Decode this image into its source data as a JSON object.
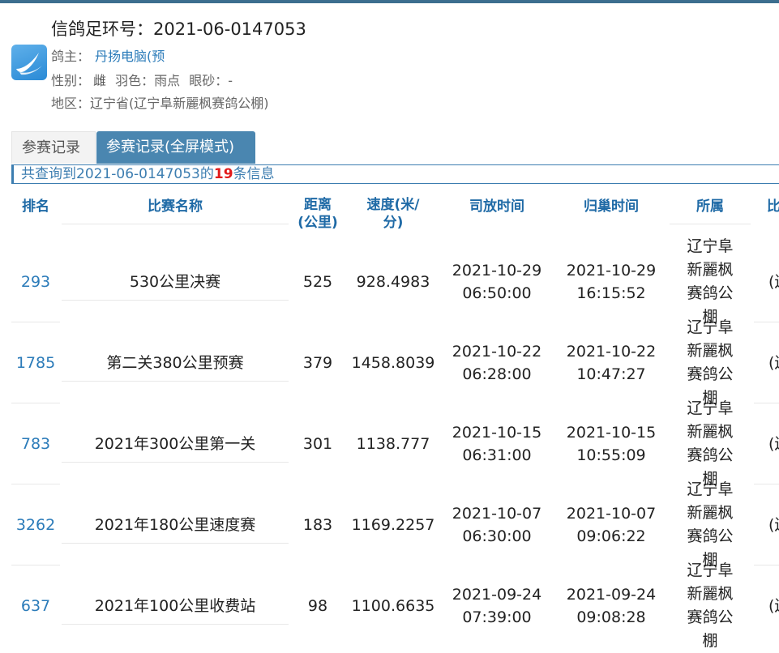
{
  "header": {
    "ring_label": "信鸽足环号：",
    "ring_number": "2021-06-0147053",
    "owner_label": "鸽主：",
    "owner_name": "丹扬电脑(预",
    "gender_label": "性别：",
    "gender_value": "雌",
    "color_label": "羽色：",
    "color_value": "雨点",
    "eye_label": "眼砂：",
    "eye_value": "-",
    "region_label": "地区：",
    "region_value": "辽宁省(辽宁阜新麗枫赛鸽公棚)"
  },
  "tabs": [
    {
      "label": "参赛记录",
      "active": false
    },
    {
      "label": "参赛记录(全屏模式)",
      "active": true
    }
  ],
  "summary": {
    "prefix": "共查询到",
    "ring": "2021-06-0147053",
    "mid": "的",
    "count": "19",
    "suffix": "条信息"
  },
  "table": {
    "columns": [
      "排名",
      "比赛名称",
      "距离(公里)",
      "速度(米/分)",
      "司放时间",
      "归巢时间",
      "所属",
      "比"
    ],
    "rows": [
      {
        "rank": "293",
        "race": "530公里决赛",
        "distance": "525",
        "speed": "928.4983",
        "release": "2021-10-29\n06:50:00",
        "arrival": "2021-10-29\n16:15:52",
        "org": "辽宁阜新麗枫赛鸽公棚",
        "extra": "(辽\n归"
      },
      {
        "rank": "1785",
        "race": "第二关380公里预赛",
        "distance": "379",
        "speed": "1458.8039",
        "release": "2021-10-22\n06:28:00",
        "arrival": "2021-10-22\n10:47:27",
        "org": "辽宁阜新麗枫赛鸽公棚",
        "extra": "(辽\n归"
      },
      {
        "rank": "783",
        "race": "2021年300公里第一关",
        "distance": "301",
        "speed": "1138.777",
        "release": "2021-10-15\n06:31:00",
        "arrival": "2021-10-15\n10:55:09",
        "org": "辽宁阜新麗枫赛鸽公棚",
        "extra": "(辽\n归"
      },
      {
        "rank": "3262",
        "race": "2021年180公里速度赛",
        "distance": "183",
        "speed": "1169.2257",
        "release": "2021-10-07\n06:30:00",
        "arrival": "2021-10-07\n09:06:22",
        "org": "辽宁阜新麗枫赛鸽公棚",
        "extra": "(辽\n归"
      },
      {
        "rank": "637",
        "race": "2021年100公里收费站",
        "distance": "98",
        "speed": "1100.6635",
        "release": "2021-09-24\n07:39:00",
        "arrival": "2021-09-24\n09:08:28",
        "org": "辽宁阜新麗枫赛鸽公棚",
        "extra": "(辽\n归"
      }
    ]
  },
  "colors": {
    "accent": "#2b7bb9",
    "header_text": "#1f6aa6",
    "tab_active": "#4a86b0",
    "count_highlight": "#e21b1b"
  },
  "icons": {
    "logo": "pigeon-logo-icon"
  }
}
